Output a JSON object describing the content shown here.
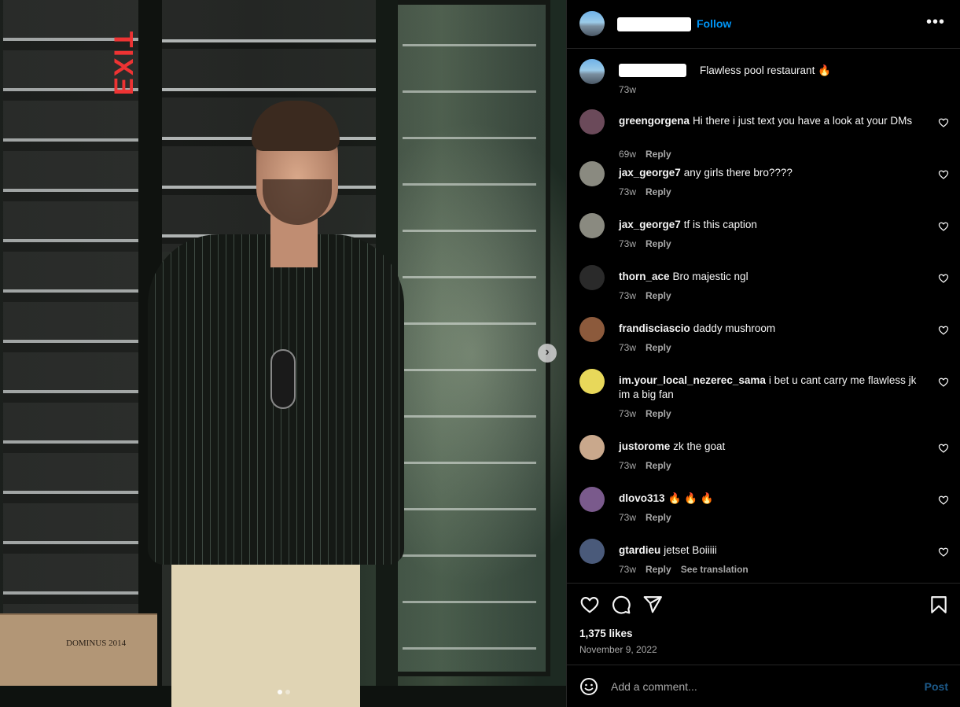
{
  "post": {
    "follow_label": "Follow",
    "more_label": "•••",
    "caption": {
      "text": "Flawless pool restaurant 🔥",
      "time": "73w"
    },
    "comments": [
      {
        "user": "greengorgena",
        "text": "Hi there i just text you have a look at your DMs",
        "time": "69w",
        "reply": "Reply",
        "avatar_color": "#6b4a5a"
      },
      {
        "user": "jax_george7",
        "text": "any girls there bro????",
        "time": "73w",
        "reply": "Reply",
        "avatar_color": "#8a8a80"
      },
      {
        "user": "jax_george7",
        "text": "tf is this caption",
        "time": "73w",
        "reply": "Reply",
        "avatar_color": "#8a8a80"
      },
      {
        "user": "thorn_ace",
        "text": "Bro majestic ngl",
        "time": "73w",
        "reply": "Reply",
        "avatar_color": "#2a2a2a"
      },
      {
        "user": "frandisciascio",
        "text": "daddy mushroom",
        "time": "73w",
        "reply": "Reply",
        "avatar_color": "#8c5a3c"
      },
      {
        "user": "im.your_local_nezerec_sama",
        "text": "i bet u cant carry me flawless jk im a big fan",
        "time": "73w",
        "reply": "Reply",
        "avatar_color": "#e8d85a"
      },
      {
        "user": "justorome",
        "text": "zk the goat",
        "time": "73w",
        "reply": "Reply",
        "avatar_color": "#c9a88c"
      },
      {
        "user": "dlovo313",
        "text": "🔥 🔥 🔥",
        "time": "73w",
        "reply": "Reply",
        "avatar_color": "#7a5a8c"
      },
      {
        "user": "gtardieu",
        "text": "jetset Boiiiii",
        "time": "73w",
        "reply": "Reply",
        "translate": "See translation",
        "avatar_color": "#4a5a7a"
      }
    ],
    "likes": "1,375 likes",
    "date": "November 9, 2022",
    "comment_placeholder": "Add a comment...",
    "post_label": "Post",
    "next_arrow": "›"
  },
  "photo": {
    "exit_sign": "EXIT",
    "crate_text": "DOMINUS 2014"
  },
  "icons": {
    "like": "heart-icon",
    "comment": "comment-icon",
    "share": "paper-plane-icon",
    "save": "bookmark-icon",
    "emoji": "smiley-icon",
    "next": "chevron-right-icon",
    "more": "more-horizontal-icon"
  }
}
